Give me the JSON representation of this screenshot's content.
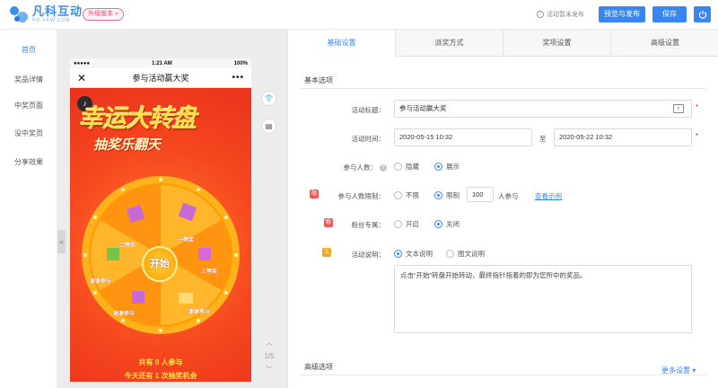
{
  "brand": {
    "name": "凡科互动",
    "sub": "HD.FKW.COM"
  },
  "topbar": {
    "upgrade_label": "升级版本 »",
    "status_icon": "info-icon",
    "status_text": "活动暂未发布",
    "preview_publish_label": "预览与发布",
    "save_label": "保存",
    "power_icon": "power-icon"
  },
  "leftnav": {
    "items": [
      {
        "label": "首页",
        "active": true
      },
      {
        "label": "奖品详情"
      },
      {
        "label": "中奖页面"
      },
      {
        "label": "没中奖页"
      },
      {
        "label": "分享效果"
      }
    ],
    "collapse_label": "«"
  },
  "phone": {
    "signal": "●●●●●",
    "time": "1:21 AM",
    "battery": "100%",
    "title": "参与活动赢大奖",
    "close": "✕",
    "more": "•••",
    "banner_main": "幸运大转盘",
    "banner_sub": "抽奖乐翻天",
    "start_label": "开始",
    "prizes": [
      "二等奖",
      "一等奖",
      "三等奖",
      "谢谢参与",
      "谢谢参与",
      "谢谢参与"
    ],
    "joined_line1": "共有 0 人参与",
    "joined_line2": "今天还有 1 次抽奖机会"
  },
  "pager": {
    "up": "︿",
    "page": "1/5",
    "down": "﹀"
  },
  "tabs": [
    "基础设置",
    "派奖方式",
    "奖项设置",
    "高级设置"
  ],
  "basic": {
    "section_title": "基本选项",
    "title_label": "活动标题：",
    "title_value": "参与活动赢大奖",
    "time_label": "活动时间：",
    "start_time": "2020-05-15 10:32",
    "to_label": "至",
    "end_time": "2020-05-22 10:32",
    "participants_label": "参与人数：",
    "participants_options": [
      "隐藏",
      "展示"
    ],
    "limit_label": "参与人数限制：",
    "limit_options": [
      "不限",
      "限制"
    ],
    "limit_value": "100",
    "limit_unit": "人参与",
    "limit_link": "查看示例",
    "fans_label": "粉丝专属：",
    "fans_options": [
      "开启",
      "关闭"
    ],
    "desc_label": "活动说明：",
    "desc_options": [
      "文本说明",
      "图文说明"
    ],
    "desc_text": "点击“开始”转盘开始转动，最终指针指着的即为您所中的奖品。"
  },
  "advanced": {
    "section_title": "高级选项",
    "more_label": "更多设置 ▾"
  },
  "colors": {
    "accent": "#3a86f0",
    "stage": "#f6471f",
    "required": "#e23333"
  }
}
